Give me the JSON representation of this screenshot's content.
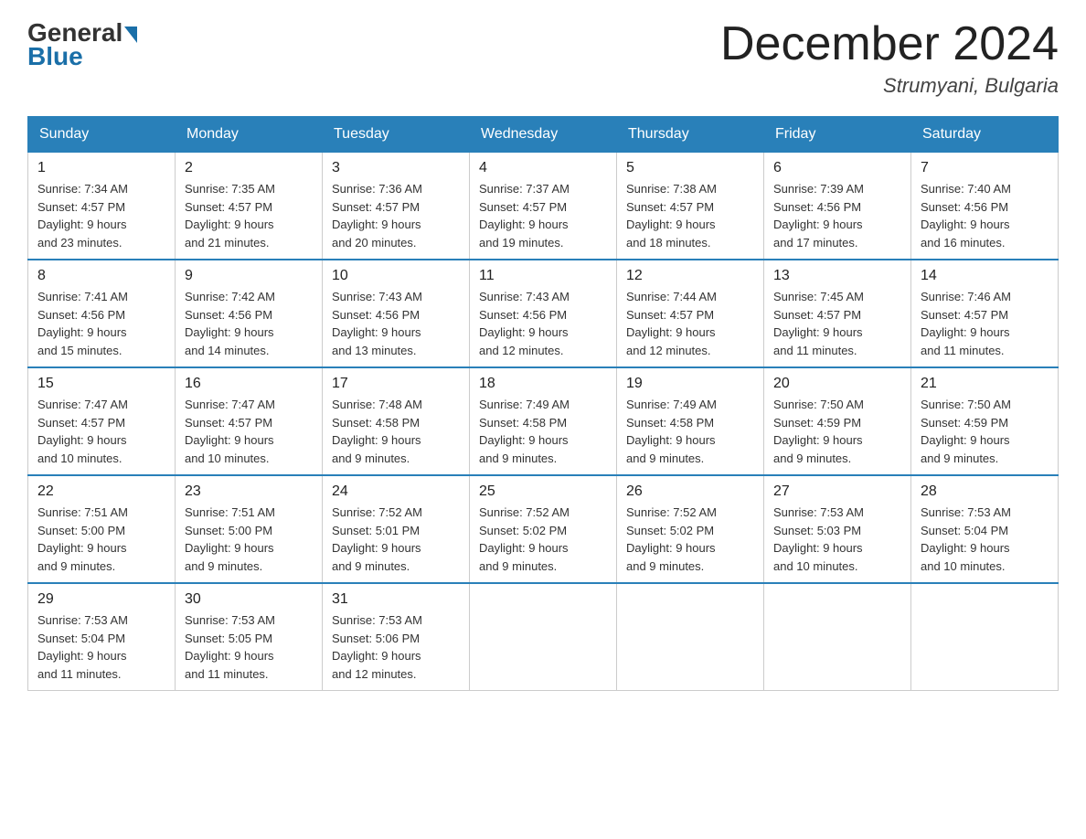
{
  "header": {
    "logo_general": "General",
    "logo_blue": "Blue",
    "month_title": "December 2024",
    "location": "Strumyani, Bulgaria"
  },
  "days_of_week": [
    "Sunday",
    "Monday",
    "Tuesday",
    "Wednesday",
    "Thursday",
    "Friday",
    "Saturday"
  ],
  "weeks": [
    [
      {
        "day": "1",
        "sunrise": "7:34 AM",
        "sunset": "4:57 PM",
        "daylight": "9 hours and 23 minutes."
      },
      {
        "day": "2",
        "sunrise": "7:35 AM",
        "sunset": "4:57 PM",
        "daylight": "9 hours and 21 minutes."
      },
      {
        "day": "3",
        "sunrise": "7:36 AM",
        "sunset": "4:57 PM",
        "daylight": "9 hours and 20 minutes."
      },
      {
        "day": "4",
        "sunrise": "7:37 AM",
        "sunset": "4:57 PM",
        "daylight": "9 hours and 19 minutes."
      },
      {
        "day": "5",
        "sunrise": "7:38 AM",
        "sunset": "4:57 PM",
        "daylight": "9 hours and 18 minutes."
      },
      {
        "day": "6",
        "sunrise": "7:39 AM",
        "sunset": "4:56 PM",
        "daylight": "9 hours and 17 minutes."
      },
      {
        "day": "7",
        "sunrise": "7:40 AM",
        "sunset": "4:56 PM",
        "daylight": "9 hours and 16 minutes."
      }
    ],
    [
      {
        "day": "8",
        "sunrise": "7:41 AM",
        "sunset": "4:56 PM",
        "daylight": "9 hours and 15 minutes."
      },
      {
        "day": "9",
        "sunrise": "7:42 AM",
        "sunset": "4:56 PM",
        "daylight": "9 hours and 14 minutes."
      },
      {
        "day": "10",
        "sunrise": "7:43 AM",
        "sunset": "4:56 PM",
        "daylight": "9 hours and 13 minutes."
      },
      {
        "day": "11",
        "sunrise": "7:43 AM",
        "sunset": "4:56 PM",
        "daylight": "9 hours and 12 minutes."
      },
      {
        "day": "12",
        "sunrise": "7:44 AM",
        "sunset": "4:57 PM",
        "daylight": "9 hours and 12 minutes."
      },
      {
        "day": "13",
        "sunrise": "7:45 AM",
        "sunset": "4:57 PM",
        "daylight": "9 hours and 11 minutes."
      },
      {
        "day": "14",
        "sunrise": "7:46 AM",
        "sunset": "4:57 PM",
        "daylight": "9 hours and 11 minutes."
      }
    ],
    [
      {
        "day": "15",
        "sunrise": "7:47 AM",
        "sunset": "4:57 PM",
        "daylight": "9 hours and 10 minutes."
      },
      {
        "day": "16",
        "sunrise": "7:47 AM",
        "sunset": "4:57 PM",
        "daylight": "9 hours and 10 minutes."
      },
      {
        "day": "17",
        "sunrise": "7:48 AM",
        "sunset": "4:58 PM",
        "daylight": "9 hours and 9 minutes."
      },
      {
        "day": "18",
        "sunrise": "7:49 AM",
        "sunset": "4:58 PM",
        "daylight": "9 hours and 9 minutes."
      },
      {
        "day": "19",
        "sunrise": "7:49 AM",
        "sunset": "4:58 PM",
        "daylight": "9 hours and 9 minutes."
      },
      {
        "day": "20",
        "sunrise": "7:50 AM",
        "sunset": "4:59 PM",
        "daylight": "9 hours and 9 minutes."
      },
      {
        "day": "21",
        "sunrise": "7:50 AM",
        "sunset": "4:59 PM",
        "daylight": "9 hours and 9 minutes."
      }
    ],
    [
      {
        "day": "22",
        "sunrise": "7:51 AM",
        "sunset": "5:00 PM",
        "daylight": "9 hours and 9 minutes."
      },
      {
        "day": "23",
        "sunrise": "7:51 AM",
        "sunset": "5:00 PM",
        "daylight": "9 hours and 9 minutes."
      },
      {
        "day": "24",
        "sunrise": "7:52 AM",
        "sunset": "5:01 PM",
        "daylight": "9 hours and 9 minutes."
      },
      {
        "day": "25",
        "sunrise": "7:52 AM",
        "sunset": "5:02 PM",
        "daylight": "9 hours and 9 minutes."
      },
      {
        "day": "26",
        "sunrise": "7:52 AM",
        "sunset": "5:02 PM",
        "daylight": "9 hours and 9 minutes."
      },
      {
        "day": "27",
        "sunrise": "7:53 AM",
        "sunset": "5:03 PM",
        "daylight": "9 hours and 10 minutes."
      },
      {
        "day": "28",
        "sunrise": "7:53 AM",
        "sunset": "5:04 PM",
        "daylight": "9 hours and 10 minutes."
      }
    ],
    [
      {
        "day": "29",
        "sunrise": "7:53 AM",
        "sunset": "5:04 PM",
        "daylight": "9 hours and 11 minutes."
      },
      {
        "day": "30",
        "sunrise": "7:53 AM",
        "sunset": "5:05 PM",
        "daylight": "9 hours and 11 minutes."
      },
      {
        "day": "31",
        "sunrise": "7:53 AM",
        "sunset": "5:06 PM",
        "daylight": "9 hours and 12 minutes."
      },
      null,
      null,
      null,
      null
    ]
  ]
}
